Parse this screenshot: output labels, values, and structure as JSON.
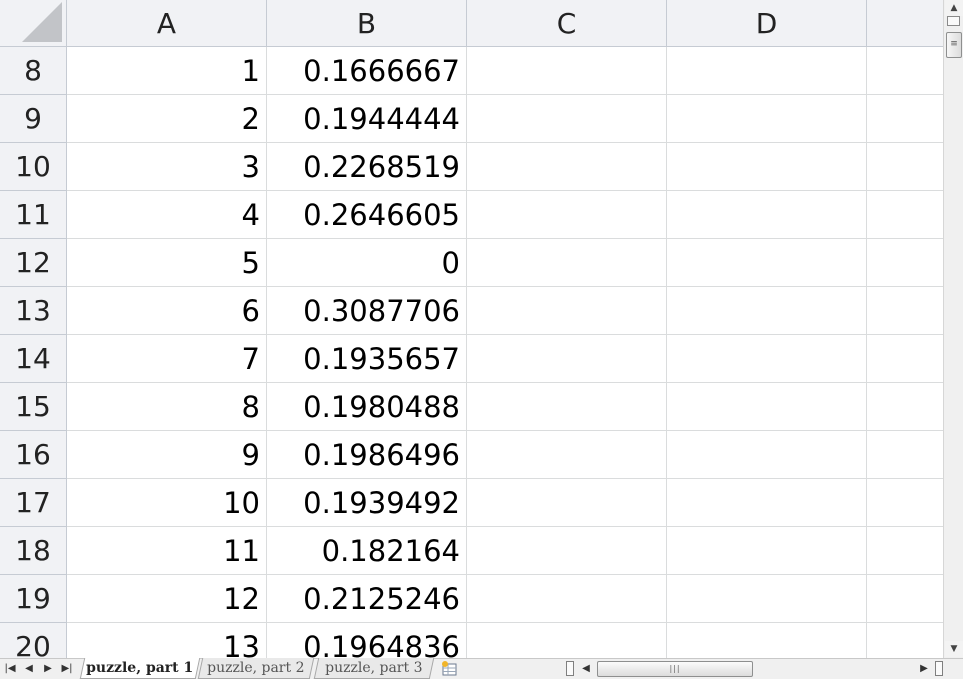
{
  "columns": [
    "A",
    "B",
    "C",
    "D"
  ],
  "rows": [
    {
      "row": "8",
      "a": "1",
      "b": "0.1666667"
    },
    {
      "row": "9",
      "a": "2",
      "b": "0.1944444"
    },
    {
      "row": "10",
      "a": "3",
      "b": "0.2268519"
    },
    {
      "row": "11",
      "a": "4",
      "b": "0.2646605"
    },
    {
      "row": "12",
      "a": "5",
      "b": "0"
    },
    {
      "row": "13",
      "a": "6",
      "b": "0.3087706"
    },
    {
      "row": "14",
      "a": "7",
      "b": "0.1935657"
    },
    {
      "row": "15",
      "a": "8",
      "b": "0.1980488"
    },
    {
      "row": "16",
      "a": "9",
      "b": "0.1986496"
    },
    {
      "row": "17",
      "a": "10",
      "b": "0.1939492"
    },
    {
      "row": "18",
      "a": "11",
      "b": "0.182164"
    },
    {
      "row": "19",
      "a": "12",
      "b": "0.2125246"
    },
    {
      "row": "20",
      "a": "13",
      "b": "0.1964836"
    }
  ],
  "sheet_tabs": [
    {
      "label": "puzzle, part 1",
      "active": true
    },
    {
      "label": "puzzle, part 2",
      "active": false
    },
    {
      "label": "puzzle, part 3",
      "active": false
    }
  ],
  "icons": {
    "nav_first": "first-sheet-icon",
    "nav_prev": "previous-sheet-icon",
    "nav_next": "next-sheet-icon",
    "nav_last": "last-sheet-icon",
    "insert_sheet": "insert-worksheet-icon",
    "scroll_up": "scroll-up-icon",
    "scroll_down": "scroll-down-icon",
    "scroll_left": "scroll-left-icon",
    "scroll_right": "scroll-right-icon"
  }
}
